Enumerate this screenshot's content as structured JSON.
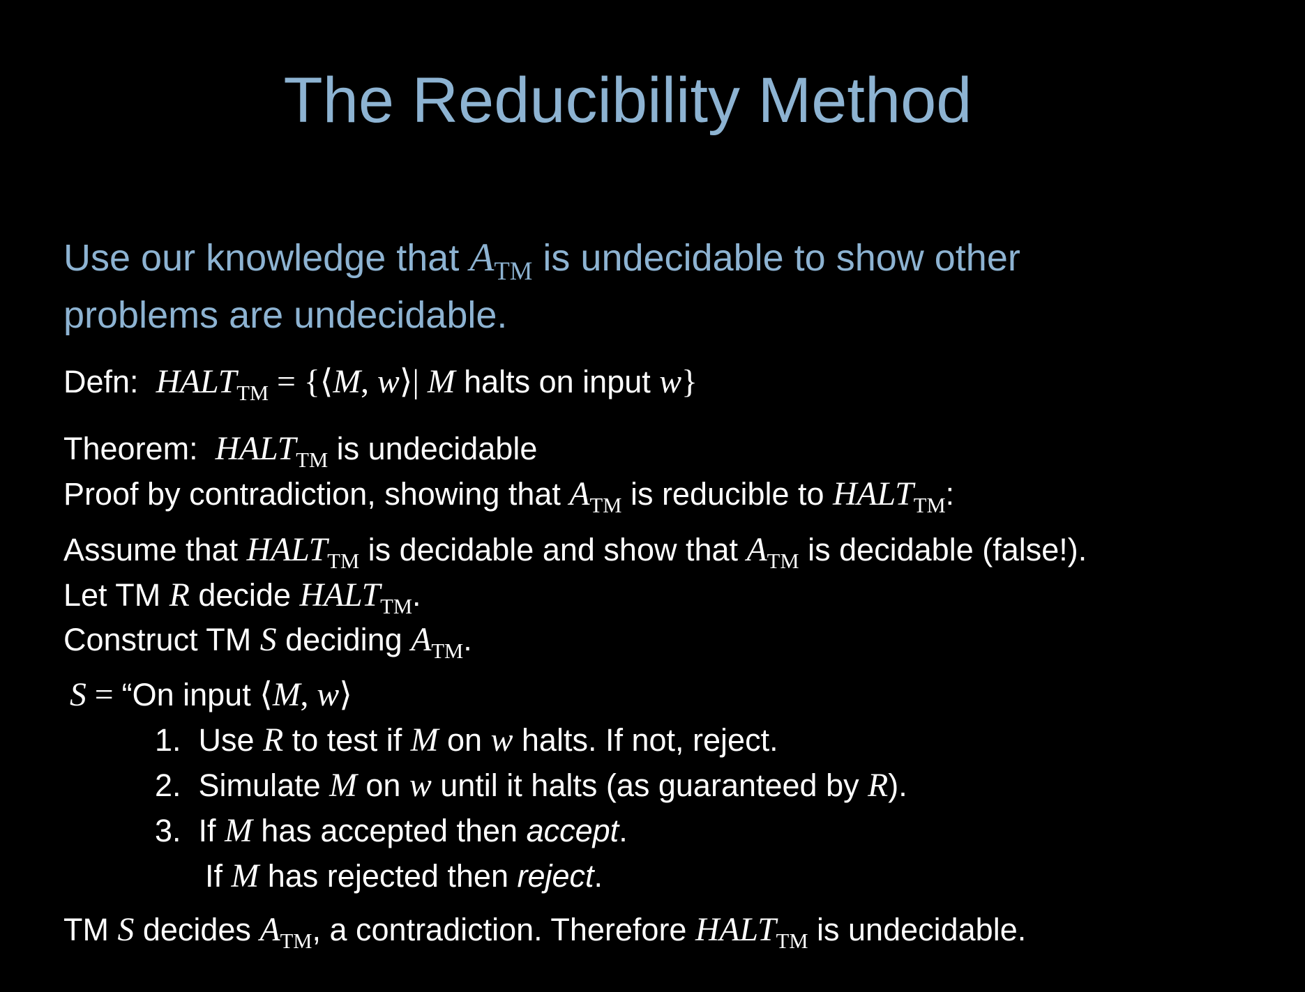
{
  "slide": {
    "title": "The Reducibility Method",
    "intro": {
      "part1": "Use our knowledge that ",
      "atm_base": "A",
      "atm_sub": "TM",
      "part2": " is undecidable to show other",
      "line2": "problems are undecidable."
    },
    "defn": {
      "label": "Defn:",
      "halt_base": "HALT",
      "halt_sub": "TM",
      "eq": " = {⟨",
      "m": "M",
      "comma": ", ",
      "w": "w",
      "close": "⟩| ",
      "m2": "M",
      "halts_text": " halts on input ",
      "w2": "w",
      "brace": "}"
    },
    "theorem": {
      "label": "Theorem:",
      "halt_base": "HALT",
      "halt_sub": "TM",
      "text": " is undecidable"
    },
    "proof": {
      "part1": "Proof by contradiction, showing that ",
      "atm_base": "A",
      "atm_sub": "TM",
      "part2": " is reducible to ",
      "halt_base": "HALT",
      "halt_sub": "TM",
      "part3": ":"
    },
    "assume": {
      "part1": "Assume that ",
      "halt_base": "HALT",
      "halt_sub": "TM",
      "part2": " is decidable and show that ",
      "atm_base": "A",
      "atm_sub": "TM",
      "part3": " is decidable (false!)."
    },
    "let": {
      "part1": "Let TM ",
      "r": "R",
      "part2": " decide ",
      "halt_base": "HALT",
      "halt_sub": "TM",
      "part3": "."
    },
    "construct": {
      "part1": "Construct TM ",
      "s": "S",
      "part2": " deciding ",
      "atm_base": "A",
      "atm_sub": "TM",
      "part3": "."
    },
    "s_def": {
      "s": "S",
      "eq": " = ",
      "text": "“On input ",
      "open": "⟨",
      "m": "M",
      "comma": ", ",
      "w": "w",
      "close": "⟩"
    },
    "step1": {
      "num": "1.",
      "part1": "Use ",
      "r": "R",
      "part2": " to test if ",
      "m": "M",
      "part3": " on ",
      "w": "w",
      "part4": " halts.  If not, reject."
    },
    "step2": {
      "num": "2.",
      "part1": "Simulate ",
      "m": "M",
      "part2": " on ",
      "w": "w",
      "part3": " until it halts (as guaranteed by ",
      "r": "R",
      "part4": ")."
    },
    "step3": {
      "num": "3.",
      "part1": "If ",
      "m": "M",
      "part2": " has accepted then ",
      "accept": "accept",
      "part3": "."
    },
    "step3b": {
      "part1": "If ",
      "m": "M",
      "part2": " has rejected then ",
      "reject": "reject",
      "part3": "."
    },
    "conclusion": {
      "part1": "TM ",
      "s": "S",
      "part2": " decides ",
      "atm_base": "A",
      "atm_sub": "TM",
      "part3": ", a contradiction.  Therefore ",
      "halt_base": "HALT",
      "halt_sub": "TM",
      "part4": " is undecidable."
    }
  }
}
